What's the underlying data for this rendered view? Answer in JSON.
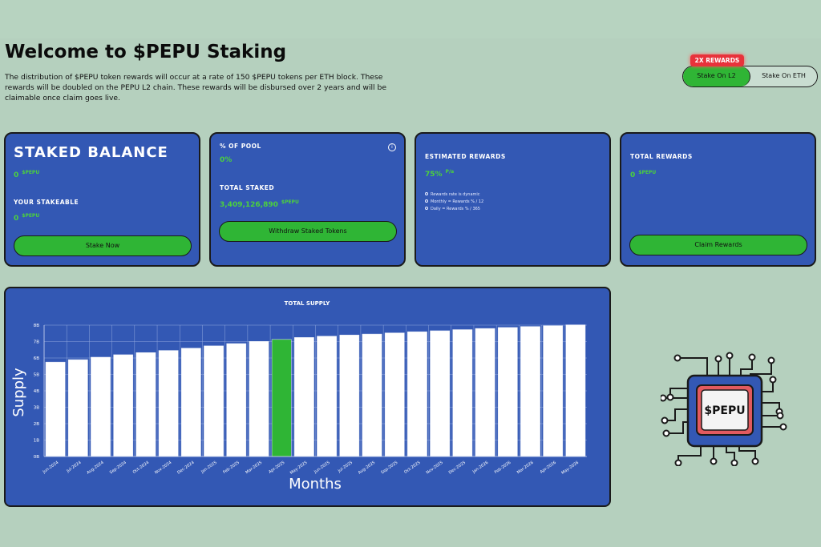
{
  "header": {
    "title": "Welcome to $PEPU Staking",
    "description": "The distribution of $PEPU token rewards will occur at a rate of 150 $PEPU tokens per ETH block. These rewards will be doubled on the PEPU L2 chain. These rewards will be disbursed over 2 years and will be claimable once claim goes live."
  },
  "toggle": {
    "badge": "2X REWARDS",
    "options": [
      "Stake On L2",
      "Stake On ETH"
    ],
    "active": "Stake On L2"
  },
  "cards": {
    "staked": {
      "title": "STAKED BALANCE",
      "balance": "0",
      "balance_unit": "$PEPU",
      "stakeable_label": "YOUR STAKEABLE",
      "stakeable": "0",
      "stakeable_unit": "$PEPU",
      "button": "Stake Now"
    },
    "pool": {
      "pool_label": "% OF POOL",
      "pool_value": "0%",
      "total_label": "TOTAL STAKED",
      "total_value": "3,409,126,890",
      "total_unit": "$PEPU",
      "button": "Withdraw Staked Tokens"
    },
    "estimated": {
      "label": "ESTIMATED REWARDS",
      "value": "75%",
      "unit": "P/a",
      "notes": [
        "Rewards rate is dynamic",
        "Monthly = Rewards % / 12",
        "Daily = Rewards % / 365"
      ]
    },
    "total_rewards": {
      "label": "TOTAL REWARDS",
      "value": "0",
      "unit": "$PEPU",
      "button": "Claim Rewards"
    }
  },
  "chip": {
    "label": "$PEPU"
  },
  "colors": {
    "background": "#b5d0be",
    "card": "#3358b4",
    "accent_green": "#2fb535",
    "value_green": "#4cd13d",
    "badge_red": "#e8323b",
    "bar_white": "#ffffff"
  },
  "chart_data": {
    "type": "bar",
    "title": "TOTAL SUPPLY",
    "xlabel": "Months",
    "ylabel": "Supply",
    "ylim": [
      0,
      80
    ],
    "yticks": [
      "0B",
      "1B",
      "2B",
      "3B",
      "4B",
      "5B",
      "6B",
      "7B",
      "8B"
    ],
    "grid": true,
    "highlight_category": "Apr-2025",
    "categories": [
      "Jun-2024",
      "Jul-2024",
      "Aug-2024",
      "Sep-2024",
      "Oct-2024",
      "Nov-2024",
      "Dec-2024",
      "Jan-2025",
      "Feb-2025",
      "Mar-2025",
      "Apr-2025",
      "May-2025",
      "Jun-2025",
      "Jul-2025",
      "Aug-2025",
      "Sep-2025",
      "Oct-2025",
      "Nov-2025",
      "Dec-2025",
      "Jan-2026",
      "Feb-2026",
      "Mar-2026",
      "Apr-2026",
      "May-2026"
    ],
    "values": [
      57.5,
      59,
      60.5,
      62,
      63.3,
      64.6,
      66,
      67.4,
      68.8,
      70.1,
      71.3,
      72.5,
      73.3,
      74,
      74.6,
      75.3,
      76,
      76.6,
      77.3,
      78,
      78.6,
      79.2,
      79.7,
      80.2
    ]
  }
}
